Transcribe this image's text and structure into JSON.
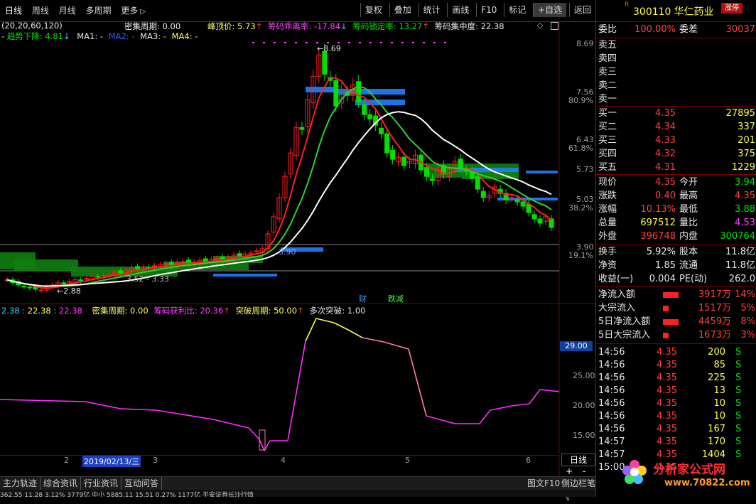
{
  "toolbar": {
    "left": [
      "日线",
      "周线",
      "月线",
      "多周期",
      "更多"
    ],
    "more_arrow": "▷",
    "right": [
      "复权",
      "叠加",
      "统计",
      "画线",
      "F10",
      "标记",
      "+自选",
      "返回"
    ]
  },
  "legend1": {
    "params": "(20,20,60,120)",
    "dense_period": "密集周期: 0.00",
    "peak_price": "峰顶价: 5.73",
    "chip_deviation": "筹码乖离率: -17.84",
    "chip_lock": "筹码锁定率: 13.27",
    "chip_concentration": "筹码集中度: 22.38"
  },
  "legend2": {
    "trend": "趋势下降: 4.81",
    "ma1": "MA1: -",
    "ma2": "MA2: -",
    "ma3": "MA3: -",
    "ma4": "MA4: -"
  },
  "price_axis": [
    "8.69",
    "7.56",
    "80.9%",
    "6.43",
    "61.8%",
    "5.73",
    "5.03",
    "38.2%",
    "3.90",
    "19.1%"
  ],
  "annotations": {
    "high": "8.69",
    "low": "2.88",
    "mid_label": "3.52 - 3.33",
    "cost_label": "3.90",
    "fin": "财",
    "report": "跌减"
  },
  "legend3": {
    "v1": "2.38",
    "v2": "22.38",
    "v3": "22.38",
    "dense_period": "密集周期: 0.00",
    "chip_profit": "筹码获利比: 20.36",
    "break_period": "突破周期: 50.00",
    "multi_break": "多次突破: 1.00"
  },
  "ind_axis": [
    "29.00",
    "25.00",
    "20.00",
    "15.00"
  ],
  "date_axis": [
    "2",
    "2019/02/13/三",
    "3",
    "4",
    "5",
    "6"
  ],
  "period_box": "日线",
  "zoom": [
    "+",
    "-"
  ],
  "bottom_tabs": [
    "主力轨迹",
    "综合资讯",
    "行业资讯",
    "互动问答"
  ],
  "bottom_right": [
    "图文F10",
    "侧边栏《",
    "笔"
  ],
  "status_text": "362.55  11.28  3.12%  3779亿   中小  5885.11  15.51  0.27%  1177亿                 平安证券长沙行情",
  "quote": {
    "code": "300110",
    "name": "华仁药业",
    "badge": "涨停",
    "weibi_label": "委比",
    "weibi": "100.00%",
    "weicha_label": "委差",
    "weicha": "30037",
    "sell": [
      {
        "label": "卖五",
        "price": "",
        "vol": ""
      },
      {
        "label": "卖四",
        "price": "",
        "vol": ""
      },
      {
        "label": "卖三",
        "price": "",
        "vol": ""
      },
      {
        "label": "卖二",
        "price": "",
        "vol": ""
      },
      {
        "label": "卖一",
        "price": "",
        "vol": ""
      }
    ],
    "buy": [
      {
        "label": "买一",
        "price": "4.35",
        "vol": "27895"
      },
      {
        "label": "买二",
        "price": "4.34",
        "vol": "337"
      },
      {
        "label": "买三",
        "price": "4.33",
        "vol": "201"
      },
      {
        "label": "买四",
        "price": "4.32",
        "vol": "375"
      },
      {
        "label": "买五",
        "price": "4.31",
        "vol": "1229"
      }
    ],
    "stats": [
      {
        "l1": "现价",
        "v1": "4.35",
        "l2": "今开",
        "v2": "3.94",
        "c1": "#ff4040",
        "c2": "#00e000"
      },
      {
        "l1": "涨跌",
        "v1": "0.40",
        "l2": "最高",
        "v2": "4.35",
        "c1": "#ff4040",
        "c2": "#ff4040"
      },
      {
        "l1": "涨幅",
        "v1": "10.13%",
        "l2": "最低",
        "v2": "3.88",
        "c1": "#ff4040",
        "c2": "#00e000"
      },
      {
        "l1": "总量",
        "v1": "697512",
        "l2": "量比",
        "v2": "4.53",
        "c1": "#ffff40",
        "c2": "#ff40ff"
      },
      {
        "l1": "外盘",
        "v1": "396748",
        "l2": "内盘",
        "v2": "300764",
        "c1": "#ff4040",
        "c2": "#00e000"
      }
    ],
    "stats2": [
      {
        "l1": "换手",
        "v1": "5.92%",
        "l2": "股本",
        "v2": "11.8亿",
        "c1": "#e8e8e8",
        "c2": "#e8e8e8"
      },
      {
        "l1": "净资",
        "v1": "1.85",
        "l2": "流通",
        "v2": "11.8亿",
        "c1": "#e8e8e8",
        "c2": "#e8e8e8"
      },
      {
        "l1": "收益(一)",
        "v1": "0.004",
        "l2": "PE(动)",
        "v2": "262.0",
        "c1": "#e8e8e8",
        "c2": "#e8e8e8"
      }
    ],
    "flows": [
      {
        "label": "净流入额",
        "value": "3917万",
        "pct": "14%",
        "bar": 0.55
      },
      {
        "label": "大宗流入",
        "value": "1517万",
        "pct": "5%",
        "bar": 0.2
      },
      {
        "label": "5日净流入额",
        "value": "4459万",
        "pct": "8%",
        "bar": 0.55
      },
      {
        "label": "5日大宗流入",
        "value": "1673万",
        "pct": "3%",
        "bar": 0.2
      }
    ],
    "ticks": [
      {
        "time": "14:56",
        "price": "4.35",
        "vol": "200",
        "side": "S"
      },
      {
        "time": "14:56",
        "price": "4.35",
        "vol": "85",
        "side": "S"
      },
      {
        "time": "14:56",
        "price": "4.35",
        "vol": "225",
        "side": "S"
      },
      {
        "time": "14:56",
        "price": "4.35",
        "vol": "13",
        "side": "S"
      },
      {
        "time": "14:56",
        "price": "4.35",
        "vol": "10",
        "side": "S"
      },
      {
        "time": "14:56",
        "price": "4.35",
        "vol": "10",
        "side": "S"
      },
      {
        "time": "14:56",
        "price": "4.35",
        "vol": "167",
        "side": "S"
      },
      {
        "time": "14:57",
        "price": "4.35",
        "vol": "170",
        "side": "S"
      },
      {
        "time": "14:57",
        "price": "4.35",
        "vol": "1404",
        "side": "S"
      },
      {
        "time": "15:00",
        "price": "4.35",
        "vol": "",
        "side": ""
      }
    ]
  },
  "watermark": {
    "main": "分析家公式网",
    "url": "www.70822.com"
  },
  "colors": {
    "up": "#ff2020",
    "down": "#00e000",
    "ma_white": "#ffffff",
    "ma_red": "#ff2020",
    "ma_green": "#30d030",
    "chip_blue": "#2080ff",
    "indicator_pink": "#ff80a0",
    "indicator_yellow": "#ffff40",
    "indicator_magenta": "#ff30ff"
  }
}
